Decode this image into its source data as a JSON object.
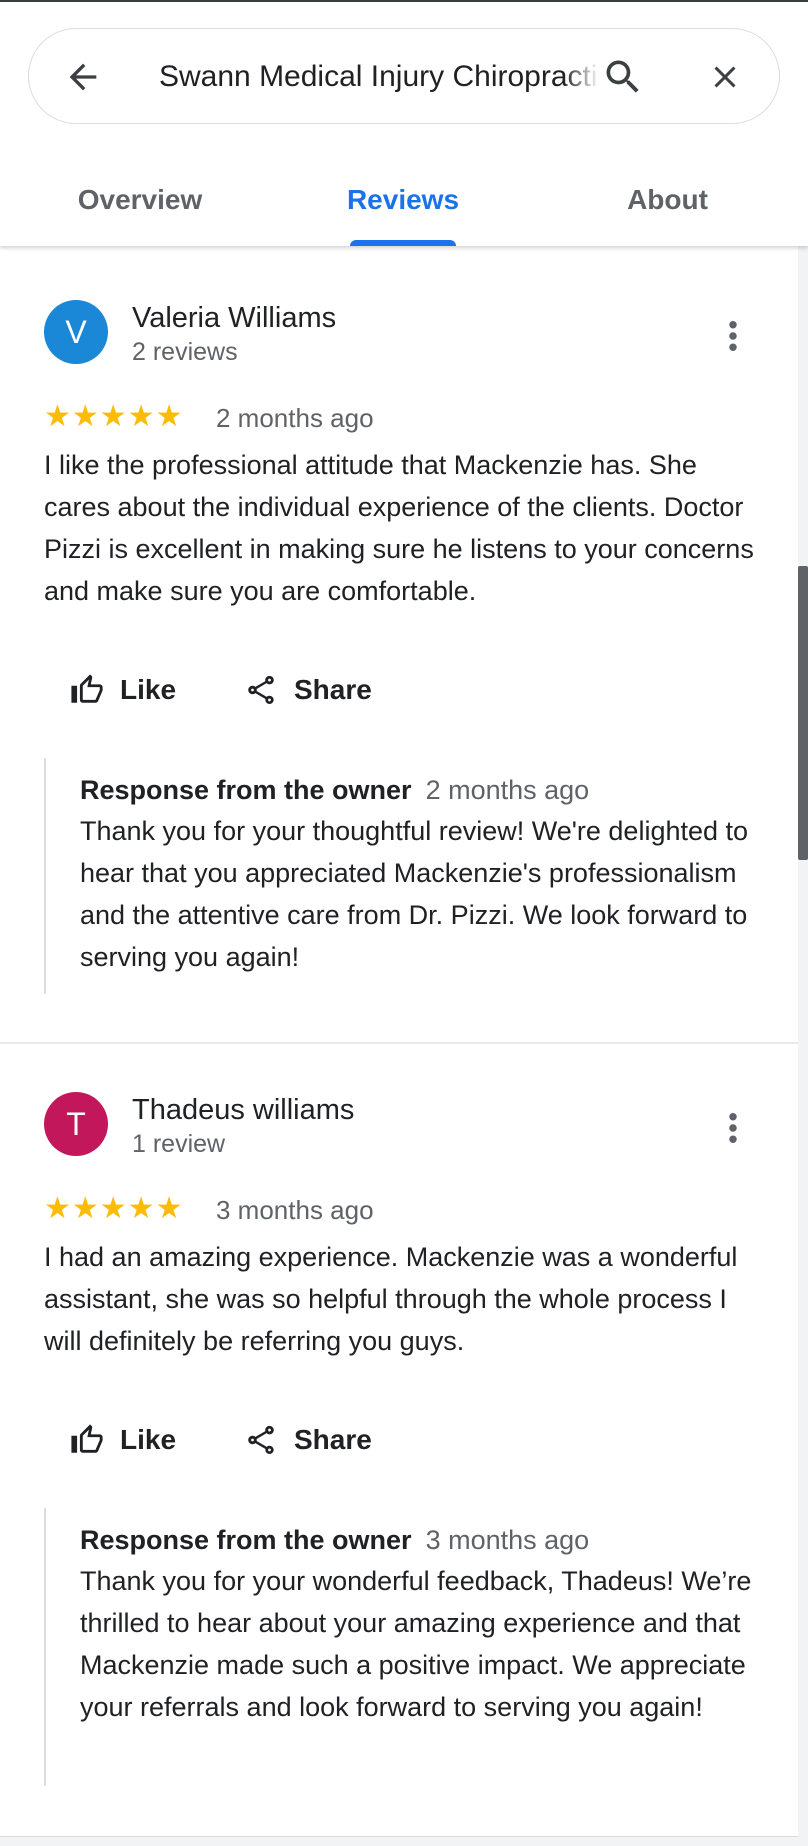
{
  "search": {
    "query": "Swann Medical Injury Chiropractic"
  },
  "tabs": [
    {
      "label": "Overview"
    },
    {
      "label": "Reviews",
      "active": true
    },
    {
      "label": "About"
    }
  ],
  "colors": {
    "accent": "#1a73e8",
    "star": "#fbbc04",
    "avatar_v": "#1a88d6",
    "avatar_t": "#c2185b"
  },
  "reviews": [
    {
      "avatar_letter": "V",
      "name": "Valeria Williams",
      "review_count": "2 reviews",
      "stars": "★★★★★",
      "rating": 5,
      "date": "2 months ago",
      "text": "I like the professional attitude that Mackenzie has. She cares about the individual experience of the clients. Doctor Pizzi is excellent in making sure he listens to your concerns and make sure you are comfortable.",
      "like_label": "Like",
      "share_label": "Share",
      "response": {
        "title": "Response from the owner",
        "date": "2 months ago",
        "text": "Thank you for your thoughtful review! We're delighted to hear that you appreciated Mackenzie's professionalism and the attentive care from Dr. Pizzi. We look forward to serving you again!"
      }
    },
    {
      "avatar_letter": "T",
      "name": "Thadeus williams",
      "review_count": "1 review",
      "stars": "★★★★★",
      "rating": 5,
      "date": "3 months ago",
      "text": "I had an amazing experience. Mackenzie was a wonderful assistant, she was so helpful through the whole process I will definitely be referring you guys.",
      "like_label": "Like",
      "share_label": "Share",
      "response": {
        "title": "Response from the owner",
        "date": "3 months ago",
        "text": "Thank you for your wonderful feedback, Thadeus! We’re thrilled to hear about your amazing experience and that Mackenzie made such a positive impact. We appreciate your referrals and look forward to serving you again!"
      }
    }
  ]
}
